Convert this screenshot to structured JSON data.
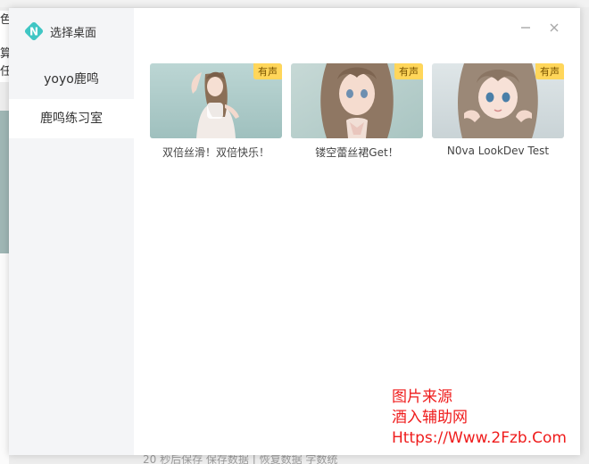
{
  "background": {
    "status_text": "20 秒后保存  保存数据 | 恢复数据    字数统",
    "left_strip_glyphs": [
      "色",
      "算",
      "任"
    ]
  },
  "dialog": {
    "title": "选择桌面",
    "logo_letter": "N",
    "sidebar": {
      "items": [
        {
          "label": "yoyo鹿鸣",
          "active": false
        },
        {
          "label": "鹿鸣练习室",
          "active": true
        }
      ]
    },
    "window_controls": {
      "minimize": "minimize-icon",
      "close": "close-icon"
    },
    "cards": [
      {
        "title": "双倍丝滑！双倍快乐！",
        "badge": "有声"
      },
      {
        "title": "镂空蕾丝裙Get！",
        "badge": "有声"
      },
      {
        "title": "N0va LookDev Test",
        "badge": "有声"
      }
    ]
  },
  "watermark": {
    "line1": "图片来源",
    "line2": "酒入辅助网",
    "line3": "Https://Www.2Fzb.Com"
  },
  "colors": {
    "accent": "#3fc6c4",
    "badge": "#ffd65a",
    "sidebar_bg": "#f4f5f7",
    "watermark": "#ef1c1c"
  }
}
